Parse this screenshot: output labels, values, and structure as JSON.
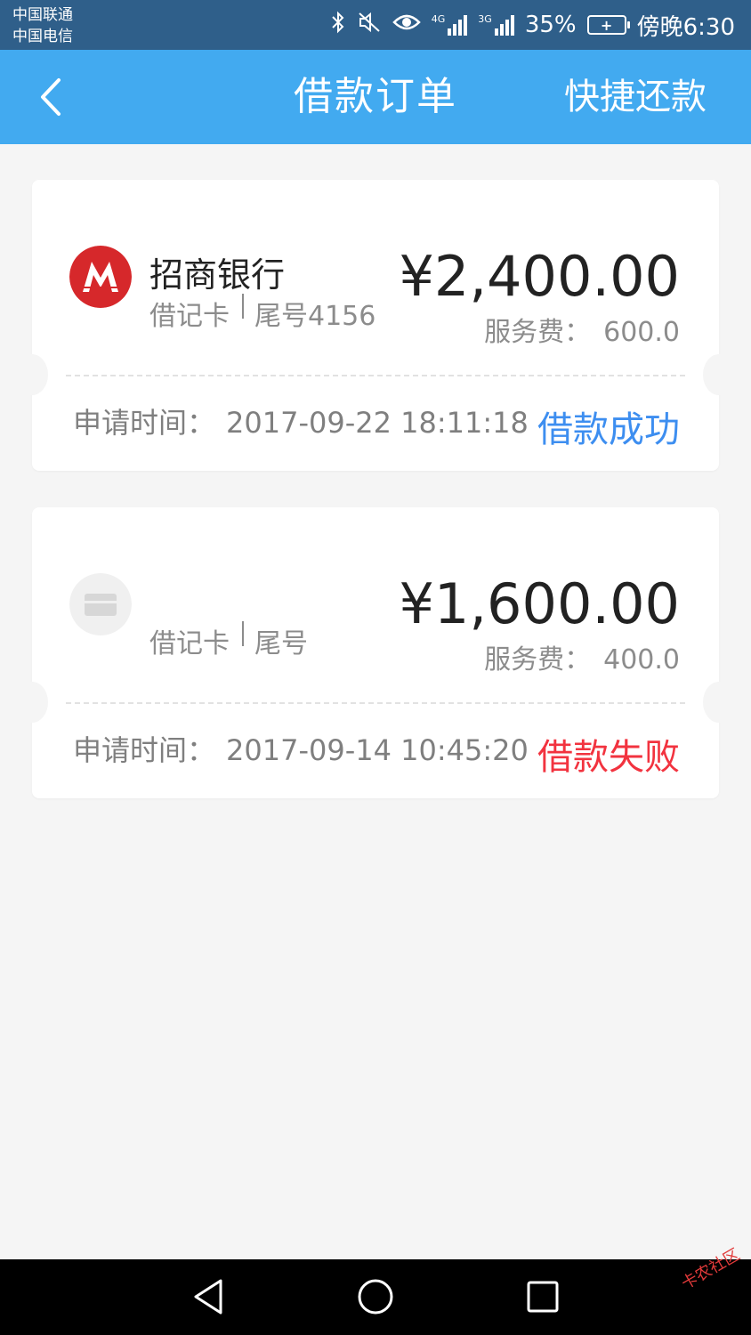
{
  "status_bar": {
    "carrier_1": "中国联通",
    "carrier_2": "中国电信",
    "battery_percent": "35%",
    "time": "傍晚6:30",
    "network_1": "4G",
    "network_2": "3G"
  },
  "header": {
    "title": "借款订单",
    "action": "快捷还款",
    "background": "#42aaf0"
  },
  "orders": [
    {
      "bank_name": "招商银行",
      "card_type": "借记卡",
      "card_tail": "尾号4156",
      "amount": "¥2,400.00",
      "fee_label": "服务费：",
      "fee_value": "600.0",
      "apply_label": "申请时间：",
      "apply_time": "2017-09-22 18:11:18",
      "status": "借款成功",
      "status_color": "#3d8ef0",
      "icon": "cmb-bank-logo-icon"
    },
    {
      "bank_name": "",
      "card_type": "借记卡",
      "card_tail": "尾号",
      "amount": "¥1,600.00",
      "fee_label": "服务费：",
      "fee_value": "400.0",
      "apply_label": "申请时间：",
      "apply_time": "2017-09-14 10:45:20",
      "status": "借款失败",
      "status_color": "#f2333f",
      "icon": "generic-card-icon"
    }
  ],
  "nav_bar": {
    "buttons": [
      "back-triangle-icon",
      "home-circle-icon",
      "recents-square-icon"
    ]
  },
  "watermark": "卡农社区"
}
